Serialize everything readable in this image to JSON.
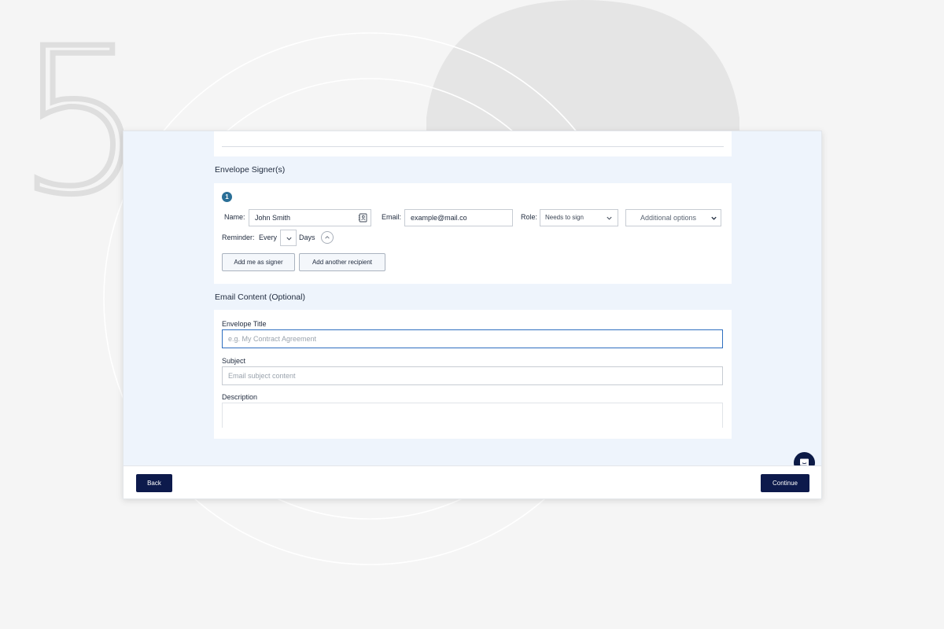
{
  "background": {
    "step_number": "5"
  },
  "sections": {
    "signers_heading": "Envelope Signer(s)",
    "email_heading": "Email Content (Optional)"
  },
  "signer": {
    "index": "1",
    "name_label": "Name:",
    "name_value": "John Smith",
    "email_label": "Email:",
    "email_value": "example@mail.co",
    "role_label": "Role:",
    "role_value": "Needs to sign",
    "additional_options": "Additional options",
    "reminder_label": "Reminder:",
    "reminder_every": "Every",
    "reminder_days": "Days",
    "add_me_button": "Add me as signer",
    "add_recipient_button": "Add another recipient"
  },
  "email_content": {
    "title_label": "Envelope Title",
    "title_placeholder": "e.g. My Contract Agreement",
    "subject_label": "Subject",
    "subject_placeholder": "Email subject content",
    "description_label": "Description"
  },
  "footer": {
    "back_label": "Back",
    "continue_label": "Continue"
  },
  "colors": {
    "primary": "#0d1a4c",
    "accent": "#2a6f97",
    "focus": "#2f6fc0",
    "panel": "#eef4fc"
  }
}
